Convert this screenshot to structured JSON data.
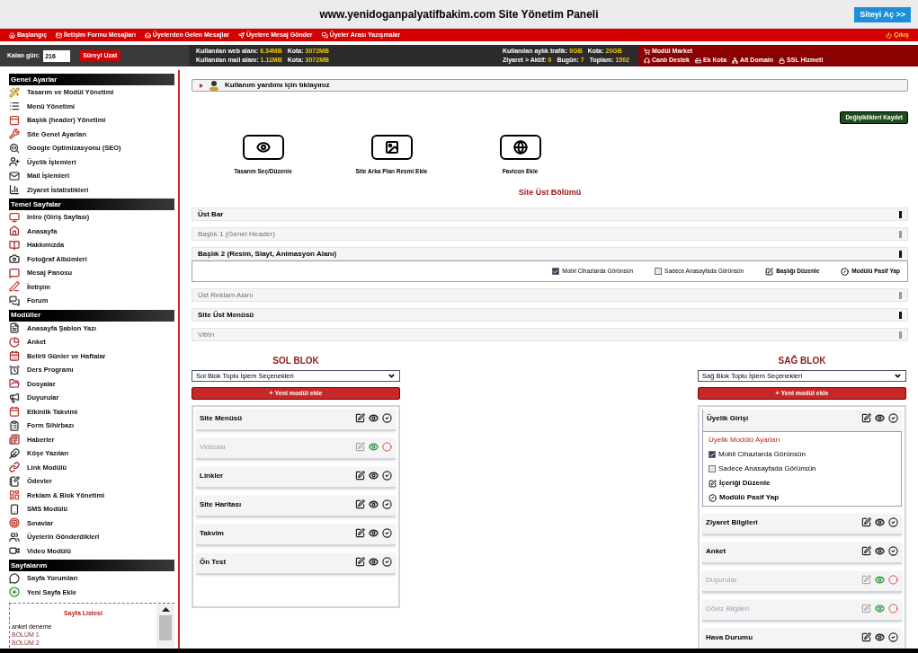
{
  "header": {
    "title": "www.yenidoganpalyatifbakim.com Site Yönetim Paneli",
    "open_site_button": "Siteyi Aç >>"
  },
  "nav": {
    "items": [
      "Başlangıç",
      "İletişim Formu Mesajları",
      "Üyelerden Gelen Mesajlar",
      "Üyelere Mesaj Gönder",
      "Üyeler Arası Yazışmalar"
    ],
    "logout": "Çıkış"
  },
  "info_bar": {
    "days_label": "Kalan gün:",
    "days_value": "216",
    "extend_button": "Süreyi Uzat",
    "usage_lines": [
      [
        {
          "label": "Kullanılan web alanı:",
          "value": "6.34MB"
        },
        {
          "label": "Kota:",
          "value": "3072MB"
        }
      ],
      [
        {
          "label": "Kullanılan mail alanı:",
          "value": "1.11MB"
        },
        {
          "label": "Kota:",
          "value": "3072MB"
        }
      ]
    ],
    "traffic_lines": [
      [
        {
          "label": "Kullanılan aylık trafik:",
          "value": "0GB"
        },
        {
          "label": "Kota:",
          "value": "20GB"
        }
      ],
      [
        {
          "label": "Ziyaret > Aktif:",
          "value": "0"
        },
        {
          "label": "Bugün:",
          "value": "7"
        },
        {
          "label": "Toplam:",
          "value": "1502"
        }
      ]
    ],
    "services_title": "Modül Market",
    "services": [
      "Canlı Destek",
      "Ek Kota",
      "Alt Domain",
      "SSL Hizmeti"
    ]
  },
  "sidebar": {
    "sections": [
      {
        "title": "Genel Ayarlar",
        "items": [
          "Tasarım ve Modül Yönetimi",
          "Menü Yönetimi",
          "Başlık (header) Yönetimi",
          "Site Genel Ayarları",
          "Google Optimizasyonu (SEO)",
          "Üyelik İşlemleri",
          "Mail İşlemleri",
          "Ziyaret İstatistikleri"
        ]
      },
      {
        "title": "Temel Sayfalar",
        "items": [
          "Intro (Giriş Sayfası)",
          "Anasayfa",
          "Hakkımızda",
          "Fotoğraf Albümleri",
          "Mesaj Panosu",
          "İletişim",
          "Forum"
        ]
      },
      {
        "title": "Modüller",
        "items": [
          "Anasayfa Şablon Yazı",
          "Anket",
          "Belirli Günler ve Haftalar",
          "Ders Programı",
          "Dosyalar",
          "Duyurular",
          "Etkinlik Takvimi",
          "Form Sihirbazı",
          "Haberler",
          "Köşe Yazıları",
          "Link Modülü",
          "Ödevler",
          "Reklam & Blok Yönetimi",
          "SMS Modülü",
          "Sınavlar",
          "Üyelerin Gönderdikleri",
          "Video Modülü"
        ]
      },
      {
        "title": "Sayfalarım",
        "items": [
          "Sayfa Yorumları",
          "Yeni Sayfa Ekle"
        ]
      }
    ],
    "page_list": {
      "title": "Sayfa Listesi",
      "pages": [
        {
          "name": "anket deneme",
          "kind": "page"
        },
        {
          "name": "BÖLÜM 1",
          "kind": "section"
        },
        {
          "name": "BÖLÜM 2",
          "kind": "section"
        }
      ]
    }
  },
  "main": {
    "help_link": "Kullanım yardımı için tıklayınız",
    "save_button": "Değişiklikleri Kaydet",
    "tools": [
      "Tasarım Seç/Düzenle",
      "Site Arka Plan Resmi Ekle",
      "Favicon Ekle"
    ],
    "top_section": {
      "title": "Site Üst Bölümü",
      "rows": [
        {
          "label": "Üst Bar",
          "active": true
        },
        {
          "label": "Başlık 1 (Genel Header)",
          "active": false
        },
        {
          "label": "Başlık 2 (Resim, Slayt, Animasyon Alanı)",
          "active": true,
          "expanded": true,
          "options": [
            {
              "kind": "checkbox",
              "label": "Mobil Cihazlarda Görünsün",
              "checked": true
            },
            {
              "kind": "checkbox",
              "label": "Sadece Anasayfada Görünsün",
              "checked": false
            },
            {
              "kind": "edit",
              "label": "Başlığı Düzenle"
            },
            {
              "kind": "deactivate",
              "label": "Modülü Pasif Yap"
            }
          ]
        },
        {
          "label": "Üst Reklam Alanı",
          "active": false
        },
        {
          "label": "Site Üst Menüsü",
          "active": true
        },
        {
          "label": "Vitrin",
          "active": false
        }
      ]
    },
    "blocks": [
      {
        "title": "SOL BLOK",
        "bulk_select": "Sol Blok Toplu İşlem Seçenekleri",
        "add_button": "+ Yeni modül ekle",
        "modules": [
          {
            "name": "Site Menüsü",
            "active": true,
            "expanded": false
          },
          {
            "name": "Videolar",
            "active": false,
            "expanded": false
          },
          {
            "name": "Linkler",
            "active": true,
            "expanded": false
          },
          {
            "name": "Site Haritası",
            "active": true,
            "expanded": false
          },
          {
            "name": "Takvim",
            "active": true,
            "expanded": false
          },
          {
            "name": "Ön Test",
            "active": true,
            "expanded": false
          }
        ]
      },
      {
        "title": "SAĞ BLOK",
        "bulk_select": "Sağ Blok Toplu İşlem Seçenekleri",
        "add_button": "+ Yeni modül ekle",
        "modules": [
          {
            "name": "Üyelik Girişi",
            "active": true,
            "expanded": true,
            "settings": {
              "title": "Üyelik Modülü Ayarları",
              "options": [
                {
                  "kind": "checkbox",
                  "label": "Mobil Cihazlarda Görünsün",
                  "checked": true
                },
                {
                  "kind": "checkbox",
                  "label": "Sadece Anasayfada Görünsün",
                  "checked": false
                },
                {
                  "kind": "edit",
                  "label": "İçeriği Düzenle"
                },
                {
                  "kind": "deactivate",
                  "label": "Modülü Pasif Yap"
                }
              ]
            }
          },
          {
            "name": "Ziyaret Bilgileri",
            "active": true,
            "expanded": false
          },
          {
            "name": "Anket",
            "active": true,
            "expanded": false
          },
          {
            "name": "Duyurular",
            "active": false,
            "expanded": false
          },
          {
            "name": "Döviz Bilgileri",
            "active": false,
            "expanded": false
          },
          {
            "name": "Hava Durumu",
            "active": true,
            "expanded": false
          }
        ]
      }
    ]
  }
}
